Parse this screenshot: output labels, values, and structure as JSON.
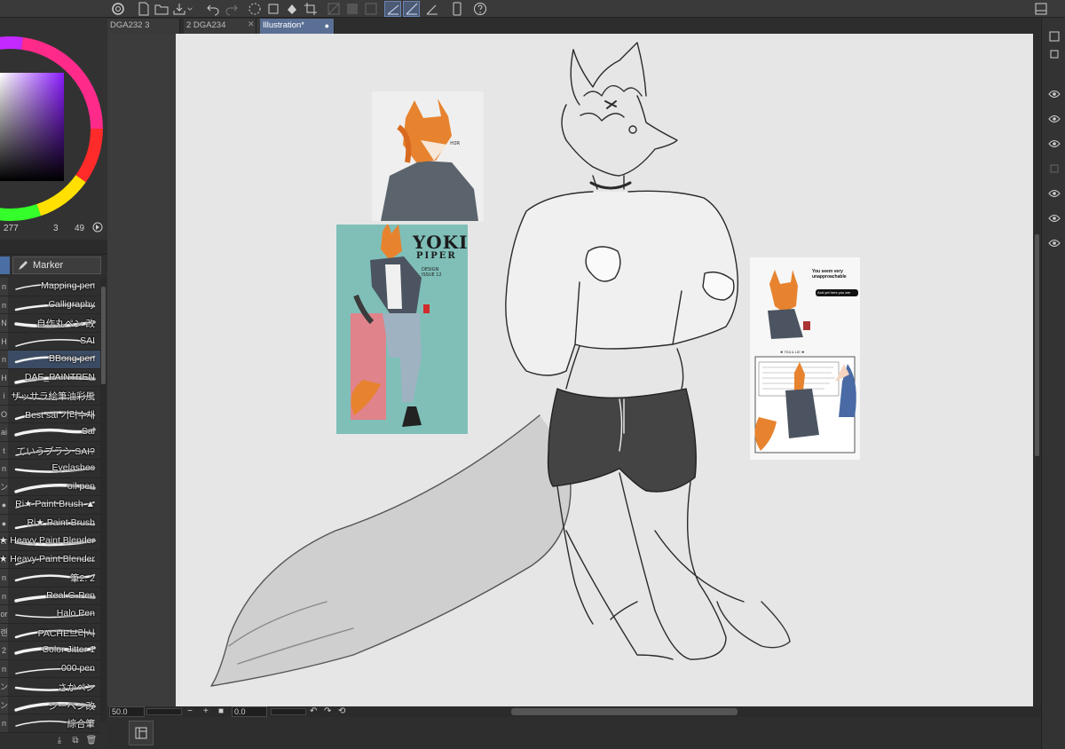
{
  "tabs": [
    {
      "label": "DGA232 3",
      "active": false
    },
    {
      "label": "2 DGA234",
      "active": false
    },
    {
      "label": "Illustration*",
      "active": true,
      "close": "●"
    }
  ],
  "color_readout": {
    "a": "277",
    "b": "3",
    "c": "49"
  },
  "brush_panel": {
    "group_label": "Marker",
    "brushes": [
      {
        "tag": "n",
        "name": "Mapping pen"
      },
      {
        "tag": "n",
        "name": "Calligraphy"
      },
      {
        "tag": "N",
        "name": "自作丸ペン 改"
      },
      {
        "tag": "H",
        "name": "SAI"
      },
      {
        "tag": "n",
        "name": "BBong pen",
        "selected": true
      },
      {
        "tag": "H",
        "name": "DAE_PAINTPEN"
      },
      {
        "tag": "i",
        "name": "ザッサラ絵筆油彩風"
      },
      {
        "tag": "O",
        "name": "Best sai 기려수채"
      },
      {
        "tag": "ai",
        "name": "Sai"
      },
      {
        "tag": "t",
        "name": "ていうブラシ SAI?"
      },
      {
        "tag": "n",
        "name": "Eyelashes"
      },
      {
        "tag": "ン",
        "name": "oil pen"
      },
      {
        "tag": "●",
        "name": "Ri★ Paint Brush ▲"
      },
      {
        "tag": "●",
        "name": "Ri★ Paint Brush"
      },
      {
        "tag": "er",
        "name": "Ri★ Heavy Paint Blender"
      },
      {
        "tag": "n",
        "name": "Ri★ Heavy Paint Blender"
      },
      {
        "tag": "n",
        "name": "筆2. 2"
      },
      {
        "tag": "n",
        "name": "Real G-Pen"
      },
      {
        "tag": "or",
        "name": "Halo Pen"
      },
      {
        "tag": "렌",
        "name": "PACHE브러시"
      },
      {
        "tag": "2",
        "name": "Color Jitter 1"
      },
      {
        "tag": "n",
        "name": "000 pen"
      },
      {
        "tag": "ン",
        "name": "さかペン"
      },
      {
        "tag": "ン",
        "name": "ジーペン改"
      },
      {
        "tag": "n",
        "name": "綜合筆"
      }
    ]
  },
  "canvas": {
    "ref_poster_title": "YOKI",
    "ref_poster_subtitle": "PIPER",
    "ref_poster_caption": "DESIGN\nISSUE 12",
    "comic_bubble_1": "You seem very unapproachable",
    "comic_bubble_2": "And yet here you are",
    "comic_panel_heading": "❀ TEA & LIE ❀"
  },
  "statusbar": {
    "zoom": "50.0",
    "minus": "−",
    "plus": "+",
    "angle": "0.0"
  },
  "colors": {
    "accent_tab": "#5a6f94",
    "panel_bg": "#323232",
    "canvas_bg": "#e6e6e6",
    "fox_orange": "#e7832f",
    "poster_teal": "#7fbfb8",
    "poster_pink": "#e0838a"
  }
}
